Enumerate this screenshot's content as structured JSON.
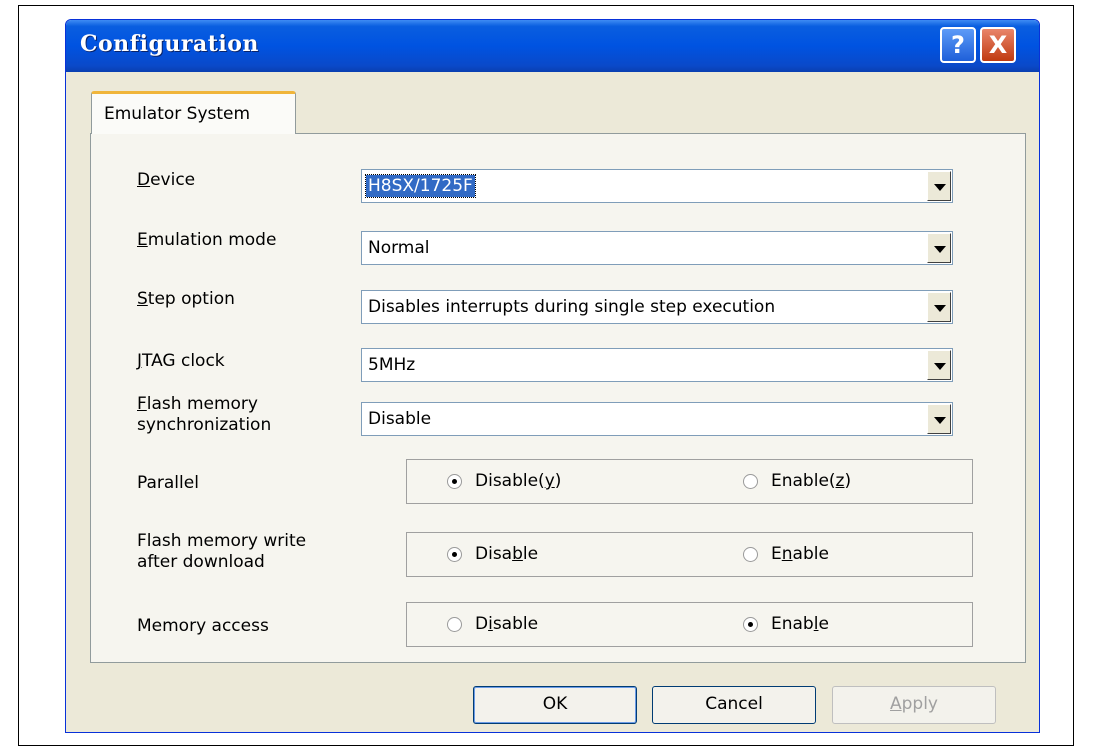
{
  "window": {
    "title": "Configuration",
    "help_label": "?",
    "close_label": "X"
  },
  "tabs": [
    {
      "label": "Emulator System",
      "selected": true
    }
  ],
  "fields": {
    "device": {
      "label_hotkey": "D",
      "label_rest": "evice",
      "value": "H8SX/1725F"
    },
    "emulation_mode": {
      "label_hotkey": "E",
      "label_rest": "mulation mode",
      "value": "Normal"
    },
    "step_option": {
      "label_hotkey": "S",
      "label_rest": "tep option",
      "value": "Disables interrupts during single step execution"
    },
    "jtag_clock": {
      "label_hotkey": "J",
      "label_rest": "TAG clock",
      "value": "5MHz"
    },
    "flash_sync": {
      "label_hotkey": "F",
      "label_line1_rest": "lash memory",
      "label_line2": "synchronization",
      "value": "Disable"
    }
  },
  "radio_groups": {
    "parallel": {
      "label": "Parallel",
      "options": [
        {
          "pre": "Disable(",
          "hotkey": "y",
          "post": ")",
          "checked": true
        },
        {
          "pre": "Enable(",
          "hotkey": "z",
          "post": ")",
          "checked": false
        }
      ]
    },
    "flash_write": {
      "label_line1": "Flash memory write",
      "label_line2": "after download",
      "options": [
        {
          "pre": "Disa",
          "hotkey": "b",
          "post": "le",
          "checked": true
        },
        {
          "pre": "E",
          "hotkey": "n",
          "post": "able",
          "checked": false
        }
      ]
    },
    "memory_access": {
      "label": "Memory access",
      "options": [
        {
          "pre": "D",
          "hotkey": "i",
          "post": "sable",
          "checked": false
        },
        {
          "pre": "Enab",
          "hotkey": "l",
          "post": "e",
          "checked": true
        }
      ]
    }
  },
  "buttons": {
    "ok": "OK",
    "cancel": "Cancel",
    "apply_hotkey": "A",
    "apply_rest": "pply"
  }
}
